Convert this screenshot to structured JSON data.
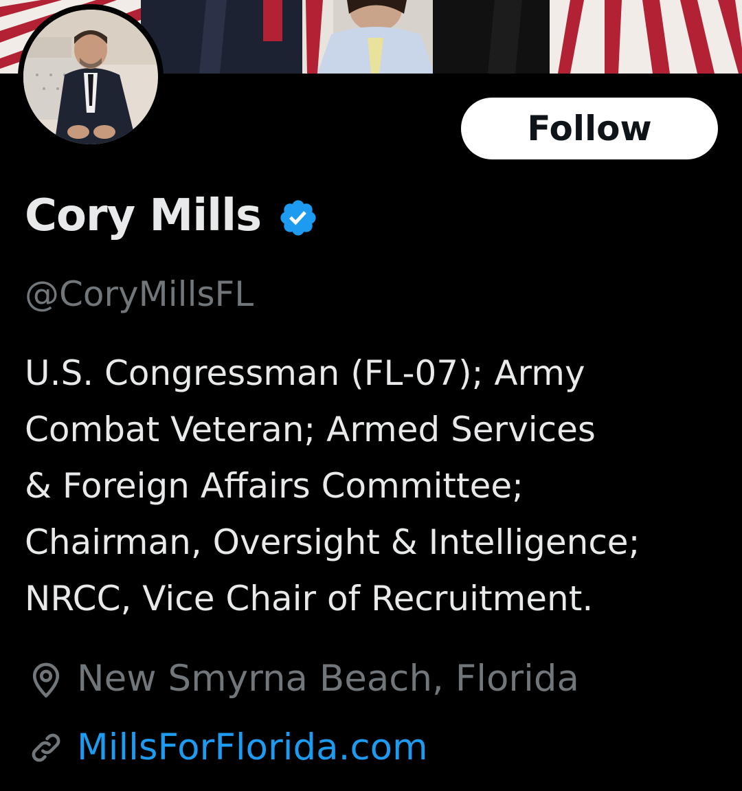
{
  "profile": {
    "display_name": "Cory Mills",
    "handle": "@CoryMillsFL",
    "verified": true,
    "bio_lines": [
      "U.S. Congressman (FL-07); Army",
      "Combat Veteran; Armed Services",
      "& Foreign Affairs Committee;",
      "Chairman, Oversight & Intelligence;",
      "NRCC, Vice Chair of Recruitment."
    ],
    "location": "New Smyrna Beach, Florida",
    "website": "MillsForFlorida.com"
  },
  "actions": {
    "follow_label": "Follow"
  },
  "icons": {
    "verified": "verified-badge-icon",
    "location": "location-pin-icon",
    "link": "link-icon"
  },
  "colors": {
    "background": "#000000",
    "primary_text": "#e7e9ea",
    "secondary_text": "#71767b",
    "link": "#1d9bf0",
    "verified_badge": "#1d9bf0",
    "follow_button_bg": "#ffffff",
    "follow_button_text": "#0f1419"
  }
}
